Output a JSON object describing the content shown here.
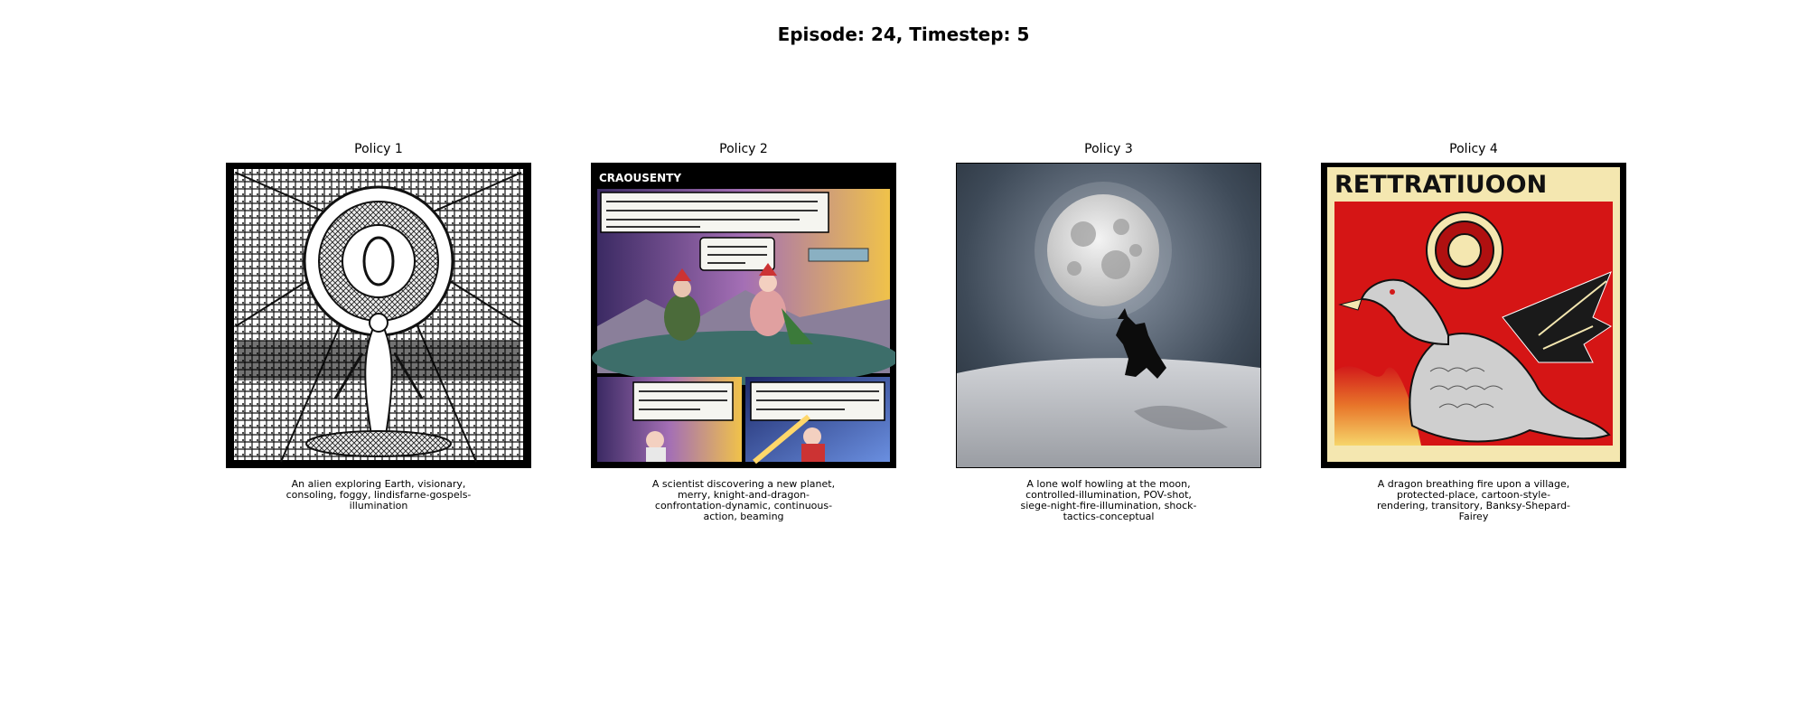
{
  "figure": {
    "title": "Episode: 24, Timestep: 5",
    "panels": [
      {
        "policy": "Policy 1",
        "caption": "An alien exploring Earth, visionary, consoling, foggy, lindisfarne-gospels-illumination",
        "image_icon": "ornate-alien-illustration"
      },
      {
        "policy": "Policy 2",
        "caption": "A scientist discovering a new planet, merry, knight-and-dragon-confrontation-dynamic, continuous-action, beaming",
        "image_icon": "comic-page-illustration",
        "image_text": "CRAOUSENTY"
      },
      {
        "policy": "Policy 3",
        "caption": "A lone wolf howling at the moon, controlled-illumination, POV-shot, siege-night-fire-illumination, shock-tactics-conceptual",
        "image_icon": "moon-wolf-illustration"
      },
      {
        "policy": "Policy 4",
        "caption": "A dragon breathing fire upon a village, protected-place, cartoon-style-rendering, transitory, Banksy-Shepard-Fairey",
        "image_icon": "dragon-poster-illustration",
        "image_text": "RETTRATIUOON"
      }
    ]
  }
}
